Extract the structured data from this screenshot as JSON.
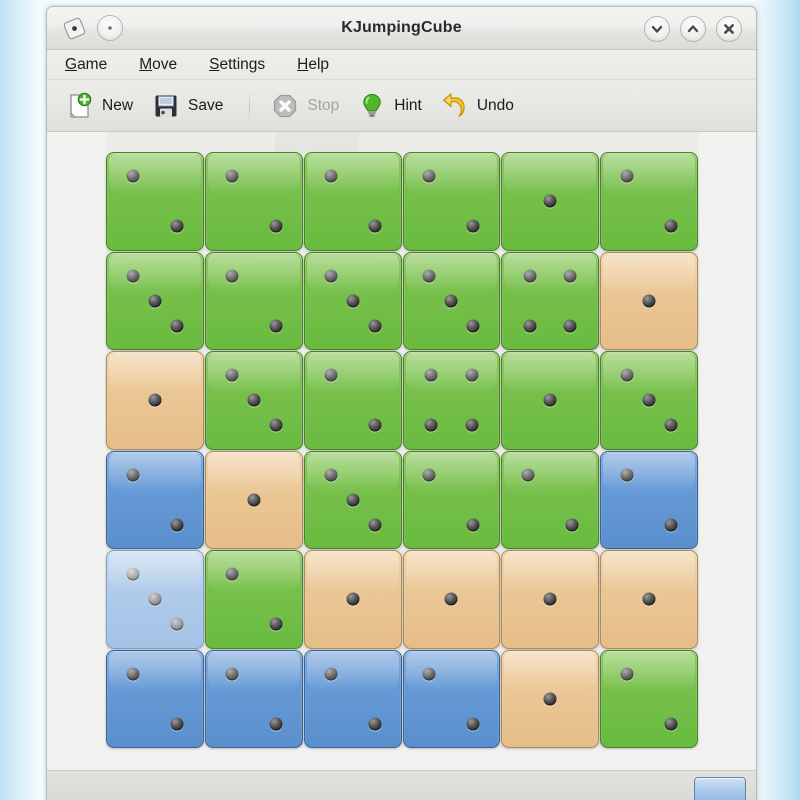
{
  "window": {
    "title": "KJumpingCube",
    "controls": {
      "app_icon": "cube-icon",
      "pin": "pin-icon",
      "minimize": "chevron-down-icon",
      "maximize": "chevron-up-icon",
      "close": "close-icon"
    }
  },
  "menubar": {
    "items": [
      {
        "label": "Game",
        "accel": "G",
        "rest": "ame"
      },
      {
        "label": "Move",
        "accel": "M",
        "rest": "ove"
      },
      {
        "label": "Settings",
        "accel": "S",
        "rest": "ettings"
      },
      {
        "label": "Help",
        "accel": "H",
        "rest": "elp"
      }
    ]
  },
  "toolbar": {
    "buttons": [
      {
        "label": "New",
        "icon": "new-document-icon",
        "enabled": true
      },
      {
        "label": "Save",
        "icon": "floppy-disk-icon",
        "enabled": true
      },
      {
        "label": "Stop",
        "icon": "stop-octagon-icon",
        "enabled": false
      },
      {
        "label": "Hint",
        "icon": "lightbulb-icon",
        "enabled": true
      },
      {
        "label": "Undo",
        "icon": "undo-arrow-icon",
        "enabled": true
      }
    ]
  },
  "colors": {
    "green": "#69bb3f",
    "tan": "#e5bd87",
    "blue": "#5a8fcd",
    "lightblue": "#a4c2e6",
    "board_background": "#ebebe8",
    "window_background": "#ececeb",
    "desktop": "#eaf6fc"
  },
  "board": {
    "rows": 6,
    "columns": 6,
    "owners": {
      "green": "player-green",
      "blue": "player-blue",
      "tan": "neutral",
      "lightblue": "highlighted"
    },
    "cells": [
      [
        {
          "color": "green",
          "value": 2
        },
        {
          "color": "green",
          "value": 2
        },
        {
          "color": "green",
          "value": 2
        },
        {
          "color": "green",
          "value": 2
        },
        {
          "color": "green",
          "value": 1
        },
        {
          "color": "green",
          "value": 2
        }
      ],
      [
        {
          "color": "green",
          "value": 3
        },
        {
          "color": "green",
          "value": 2
        },
        {
          "color": "green",
          "value": 3
        },
        {
          "color": "green",
          "value": 3
        },
        {
          "color": "green",
          "value": 4
        },
        {
          "color": "tan",
          "value": 1
        }
      ],
      [
        {
          "color": "tan",
          "value": 1
        },
        {
          "color": "green",
          "value": 3
        },
        {
          "color": "green",
          "value": 2
        },
        {
          "color": "green",
          "value": 4
        },
        {
          "color": "green",
          "value": 1
        },
        {
          "color": "green",
          "value": 3
        }
      ],
      [
        {
          "color": "blue",
          "value": 2
        },
        {
          "color": "tan",
          "value": 1
        },
        {
          "color": "green",
          "value": 3
        },
        {
          "color": "green",
          "value": 2
        },
        {
          "color": "green",
          "value": 2
        },
        {
          "color": "blue",
          "value": 2
        }
      ],
      [
        {
          "color": "lightblue",
          "value": 3
        },
        {
          "color": "green",
          "value": 2
        },
        {
          "color": "tan",
          "value": 1
        },
        {
          "color": "tan",
          "value": 1
        },
        {
          "color": "tan",
          "value": 1
        },
        {
          "color": "tan",
          "value": 1
        }
      ],
      [
        {
          "color": "blue",
          "value": 2
        },
        {
          "color": "blue",
          "value": 2
        },
        {
          "color": "blue",
          "value": 2
        },
        {
          "color": "blue",
          "value": 2
        },
        {
          "color": "tan",
          "value": 1
        },
        {
          "color": "green",
          "value": 2
        }
      ]
    ]
  }
}
